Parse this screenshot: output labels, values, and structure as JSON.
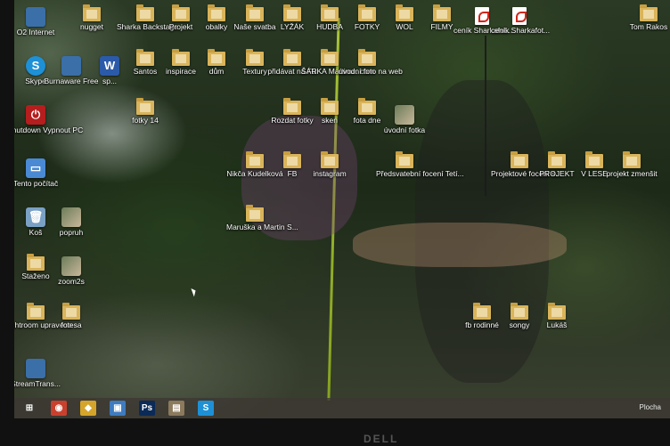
{
  "colors": {
    "folder": "#d9b45a",
    "taskbar": "#3c3732",
    "skype": "#1e90d6",
    "photoshop": "#0b2a57",
    "rope": "#b7d33a"
  },
  "desktop": {
    "icons": [
      {
        "label": "O2 Internet",
        "icon": "app-icon"
      },
      {
        "label": "nugget",
        "icon": "folder-icon"
      },
      {
        "label": "Sharka Backstage",
        "icon": "folder-icon"
      },
      {
        "label": "Projekt",
        "icon": "folder-icon"
      },
      {
        "label": "obalky",
        "icon": "folder-icon"
      },
      {
        "label": "Naše svatba",
        "icon": "folder-icon"
      },
      {
        "label": "LYŽÁK",
        "icon": "folder-icon"
      },
      {
        "label": "HUDBA",
        "icon": "folder-icon"
      },
      {
        "label": "FOTKY",
        "icon": "folder-icon"
      },
      {
        "label": "WOL",
        "icon": "folder-icon"
      },
      {
        "label": "FILMY",
        "icon": "folder-icon"
      },
      {
        "label": "ceník Sharkafot...",
        "icon": "pdf-icon"
      },
      {
        "label": "ceník Sharkafot...",
        "icon": "pdf-icon"
      },
      {
        "label": "Tom Rakos",
        "icon": "folder-icon"
      },
      {
        "label": "Skype",
        "icon": "skype-icon"
      },
      {
        "label": "Burnaware Free",
        "icon": "app-icon"
      },
      {
        "label": "sp...",
        "icon": "word-icon"
      },
      {
        "label": "Santos",
        "icon": "folder-icon"
      },
      {
        "label": "inspirace",
        "icon": "folder-icon"
      },
      {
        "label": "dům",
        "icon": "folder-icon"
      },
      {
        "label": "Textury",
        "icon": "folder-icon"
      },
      {
        "label": "přidávat na FB",
        "icon": "folder-icon"
      },
      {
        "label": "ŠÁRKA Martinu . com",
        "icon": "folder-icon"
      },
      {
        "label": "úvodní foto na web",
        "icon": "folder-icon"
      },
      {
        "label": "Shutdown Vypnout PC",
        "icon": "power-icon"
      },
      {
        "label": "fotky 14",
        "icon": "folder-icon"
      },
      {
        "label": "Rozdat fotky",
        "icon": "folder-icon"
      },
      {
        "label": "sken",
        "icon": "folder-icon"
      },
      {
        "label": "fota dne",
        "icon": "folder-icon"
      },
      {
        "label": "úvodní fotka",
        "icon": "image-icon"
      },
      {
        "label": "Tento počítač",
        "icon": "computer-icon"
      },
      {
        "label": "Nikča Kudelková",
        "icon": "folder-icon"
      },
      {
        "label": "FB",
        "icon": "folder-icon"
      },
      {
        "label": "instagram",
        "icon": "folder-icon"
      },
      {
        "label": "Předsvatební focení Tetí...",
        "icon": "folder-icon"
      },
      {
        "label": "Projektové focení s...",
        "icon": "folder-icon"
      },
      {
        "label": "PROJEKT",
        "icon": "folder-icon"
      },
      {
        "label": "V LESE",
        "icon": "folder-icon"
      },
      {
        "label": "projekt zmenšit",
        "icon": "folder-icon"
      },
      {
        "label": "Koš",
        "icon": "recycle-bin-icon"
      },
      {
        "label": "popruh",
        "icon": "image-icon"
      },
      {
        "label": "Maruška a Martin S...",
        "icon": "folder-icon"
      },
      {
        "label": "Staženo",
        "icon": "folder-icon"
      },
      {
        "label": "zoom2s",
        "icon": "image-icon"
      },
      {
        "label": "fb rodinné",
        "icon": "folder-icon"
      },
      {
        "label": "songy",
        "icon": "folder-icon"
      },
      {
        "label": "Lukáš",
        "icon": "folder-icon"
      },
      {
        "label": "lightroom upraveno",
        "icon": "folder-icon"
      },
      {
        "label": "fotesa",
        "icon": "folder-icon"
      },
      {
        "label": "StreamTrans...",
        "icon": "app-icon"
      }
    ]
  },
  "taskbar": {
    "items": [
      {
        "name": "windows-start",
        "glyph": "⊞"
      },
      {
        "name": "chrome",
        "glyph": "◉"
      },
      {
        "name": "app",
        "glyph": "◆"
      },
      {
        "name": "remote",
        "glyph": "▣"
      },
      {
        "name": "photoshop",
        "glyph": "Ps"
      },
      {
        "name": "photo-viewer",
        "glyph": "▤"
      },
      {
        "name": "skype",
        "glyph": "S"
      }
    ],
    "tray_text": "Plocha"
  },
  "bezel": {
    "brand": "DELL"
  }
}
